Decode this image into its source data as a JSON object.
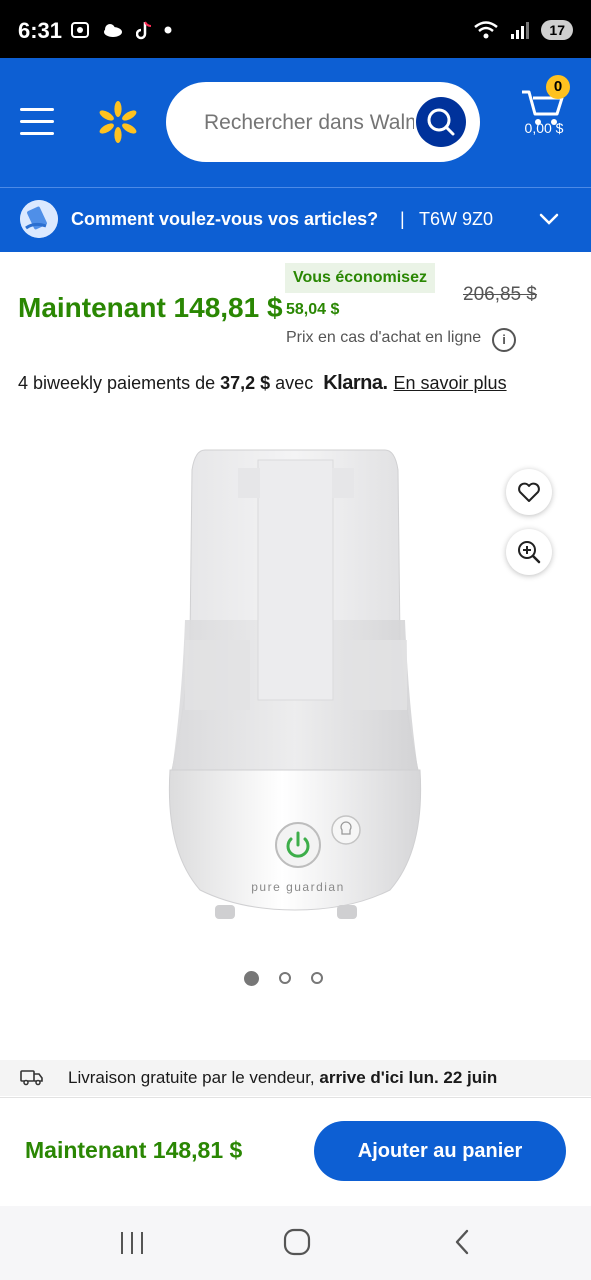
{
  "status_bar": {
    "time": "6:31",
    "battery": "17"
  },
  "header": {
    "search_placeholder": "Rechercher dans Walmart",
    "cart_badge": "0",
    "cart_total": "0,00 $"
  },
  "delivery": {
    "prompt": "Comment voulez-vous vos articles?",
    "separator": "|",
    "postal_code": "T6W 9Z0"
  },
  "price": {
    "now": "Maintenant 148,81 $",
    "savings_label": "Vous économisez",
    "savings_amount": "58,04 $",
    "was": "206,85 $",
    "online_note": "Prix en cas d'achat en ligne",
    "info_glyph": "i"
  },
  "klarna": {
    "prefix": "4 biweekly paiements de ",
    "amount": "37,2 $",
    "middle": " avec",
    "logo": "Klarna.",
    "link": "En savoir plus"
  },
  "product": {
    "brand_text": "pure guardian",
    "carousel_count": 3,
    "carousel_active": 1
  },
  "shipping": {
    "text": "Livraison gratuite par le vendeur, ",
    "eta": "arrive d'ici lun. 22 juin"
  },
  "bottom_bar": {
    "price": "Maintenant 148,81 $",
    "add_button": "Ajouter au panier"
  },
  "colors": {
    "brand_blue": "#0d5fd3",
    "dark_blue": "#00329b",
    "spark_yellow": "#ffc220",
    "price_green": "#2a8703"
  },
  "icons": [
    "menu-icon",
    "spark-logo-icon",
    "search-icon",
    "cart-icon",
    "delivery-icon",
    "chevron-down-icon",
    "info-icon",
    "heart-icon",
    "zoom-in-icon",
    "truck-icon",
    "recent-apps-icon",
    "home-icon",
    "back-icon"
  ]
}
